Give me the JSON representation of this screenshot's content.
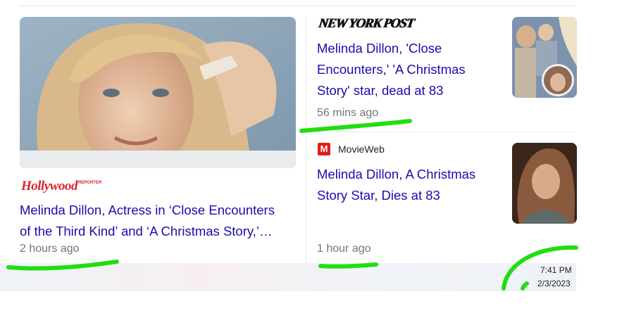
{
  "stories": [
    {
      "source": "The Hollywood Reporter",
      "source_logo_text": "Hollywood",
      "source_logo_small": "REPORTER",
      "headline_line1": "Melinda Dillon, Actress in ‘Close Encounters",
      "headline_line2": "of the Third Kind’ and ‘A Christmas Story,’…",
      "time": "2 hours ago"
    },
    {
      "source": "New York Post",
      "source_logo_text": "NEW YORK POST",
      "headline_line1": "Melinda Dillon, 'Close",
      "headline_line2": "Encounters,' 'A Christmas",
      "headline_line3": "Story' star, dead at 83",
      "time": "56 mins ago"
    },
    {
      "source": "MovieWeb",
      "source_badge": "M",
      "headline_line1": "Melinda Dillon, A Christmas",
      "headline_line2": "Story Star, Dies at 83",
      "time": "1 hour ago"
    }
  ],
  "taskbar": {
    "time": "7:41 PM",
    "date": "2/3/2023"
  },
  "colors": {
    "headline": "#1a0dab",
    "timestamp": "#70757a",
    "annotation": "#22dd11",
    "thr_red": "#d8262e",
    "movieweb_red": "#e21b1b"
  }
}
